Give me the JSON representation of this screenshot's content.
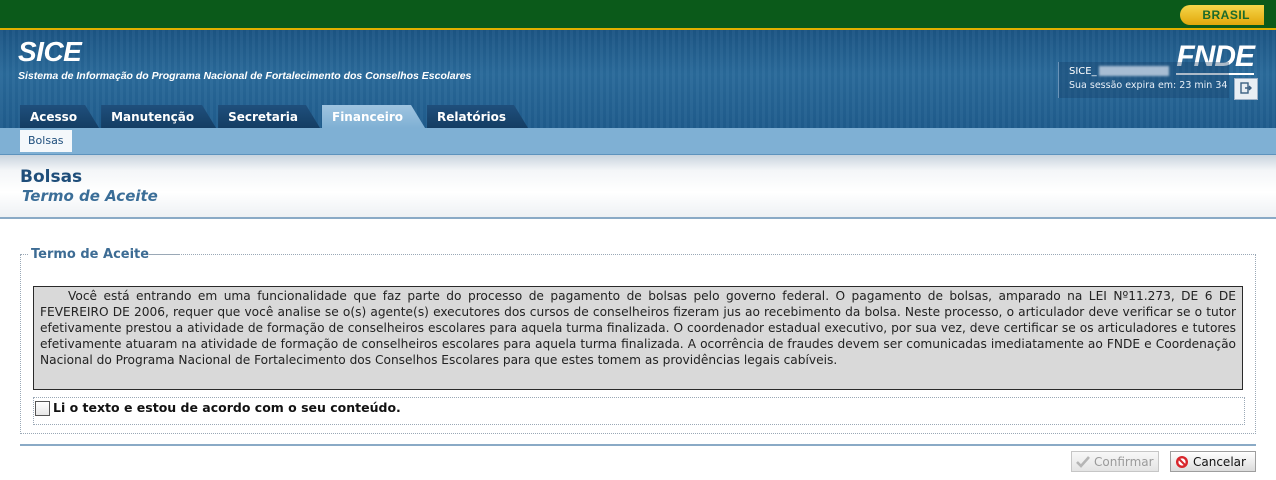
{
  "govbar": {
    "label": "BRASIL"
  },
  "header": {
    "app_title": "SICE",
    "app_subtitle": "Sistema de Informação do Programa Nacional de Fortalecimento dos Conselhos Escolares",
    "logo_text": "FNDE"
  },
  "tabs": [
    {
      "label": "Acesso",
      "active": false
    },
    {
      "label": "Manutenção",
      "active": false
    },
    {
      "label": "Secretaria",
      "active": false
    },
    {
      "label": "Financeiro",
      "active": true
    },
    {
      "label": "Relatórios",
      "active": false
    }
  ],
  "session": {
    "user": "SICE_",
    "expire_text": "Sua sessão expira em: 23 min 34"
  },
  "subnav": {
    "active_item": "Bolsas"
  },
  "page": {
    "title": "Bolsas",
    "subtitle": "Termo de Aceite"
  },
  "form": {
    "legend": "Termo de Aceite",
    "terms_text": "Você está entrando em uma funcionalidade que faz parte do processo de pagamento de bolsas pelo governo federal. O pagamento de bolsas, amparado na LEI Nº11.273, DE 6 DE FEVEREIRO DE 2006, requer que você analise se o(s) agente(s) executores dos cursos de conselheiros fizeram jus ao recebimento da bolsa. Neste processo, o articulador deve verificar se o tutor efetivamente prestou a atividade de formação de conselheiros escolares para aquela turma finalizada. O coordenador estadual executivo, por sua vez, deve certificar se os articuladores e tutores efetivamente atuaram na atividade de formação de conselheiros escolares para aquela turma finalizada. A ocorrência de fraudes devem ser comunicadas imediatamente ao FNDE e Coordenação Nacional do Programa Nacional de Fortalecimento dos Conselhos Escolares para que estes tomem as providências legais cabíveis.",
    "accept_label": "Li o texto e estou de acordo com o seu conteúdo.",
    "accept_checked": false
  },
  "buttons": {
    "confirm_label": "Confirmar",
    "confirm_enabled": false,
    "cancel_label": "Cancelar"
  },
  "icons": {
    "confirm": "check-icon",
    "cancel": "no-entry-icon",
    "logout": "logout-icon"
  },
  "colors": {
    "header_blue": "#1f5c8d",
    "gov_green": "#0b5a1a",
    "brasil_yellow": "#f6d64a",
    "title_blue": "#1f4e7a"
  }
}
